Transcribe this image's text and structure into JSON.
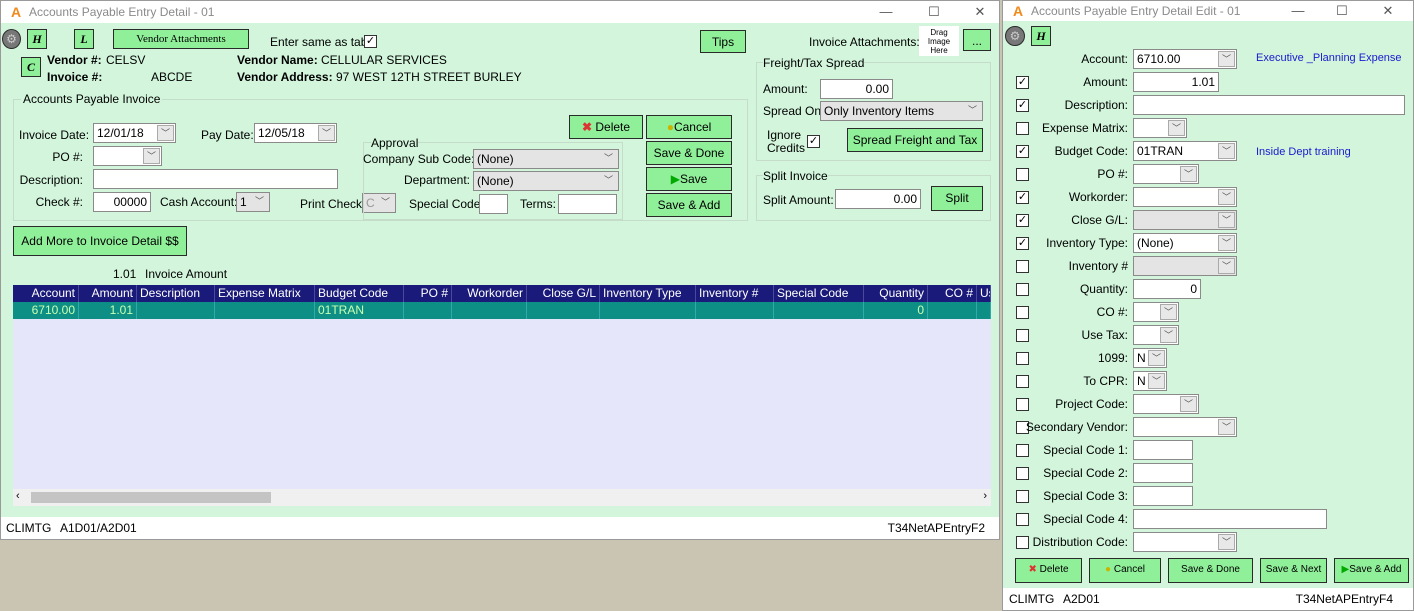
{
  "main_window": {
    "title": "Accounts Payable Entry Detail - 01",
    "toolbar": {
      "h_label": "H",
      "l_label": "L",
      "c_label": "C",
      "vendor_attachments": "Vendor Attachments",
      "enter_same_as_tab": "Enter same as tab",
      "enter_same_as_tab_checked": true,
      "tips": "Tips",
      "invoice_attachments": "Invoice Attachments:",
      "drag_image": "Drag Image Here",
      "browse": "..."
    },
    "vendor": {
      "vendor_num_label": "Vendor #:",
      "vendor_num": "CELSV",
      "invoice_num_label": "Invoice #:",
      "invoice_num": "ABCDE",
      "vendor_name_label": "Vendor Name:",
      "vendor_name": "CELLULAR SERVICES",
      "vendor_address_label": "Vendor Address:",
      "vendor_address": "97 WEST 12TH STREET  BURLEY"
    },
    "invoice": {
      "group": "Accounts Payable Invoice",
      "invoice_date_label": "Invoice Date:",
      "invoice_date": "12/01/18",
      "pay_date_label": "Pay Date:",
      "pay_date": "12/05/18",
      "po_label": "PO #:",
      "po": "",
      "description_label": "Description:",
      "description": "",
      "check_label": "Check #:",
      "check": "00000",
      "cash_account_label": "Cash Account:",
      "cash_account": "1",
      "print_check_label": "Print Check:",
      "print_check": "C",
      "terms_label": "Terms:",
      "terms": ""
    },
    "approval": {
      "group": "Approval",
      "company_sub_code_label": "Company Sub Code:",
      "company_sub_code": "(None)",
      "department_label": "Department:",
      "department": "(None)",
      "special_code_label": "Special Code:",
      "special_code": ""
    },
    "buttons": {
      "delete": "Delete",
      "cancel": "Cancel",
      "save_done": "Save & Done",
      "save": "Save",
      "save_add": "Save & Add",
      "add_more": "Add More to Invoice Detail $$"
    },
    "freight": {
      "group": "Freight/Tax Spread",
      "amount_label": "Amount:",
      "amount": "0.00",
      "spread_on_label": "Spread On:",
      "spread_on": "Only Inventory Items",
      "ignore_credits_label": "Ignore Credits",
      "ignore_credits": true,
      "spread_button": "Spread Freight and Tax"
    },
    "split": {
      "group": "Split Invoice",
      "amount_label": "Split Amount:",
      "amount": "0.00",
      "button": "Split"
    },
    "invoice_amount": "1.01",
    "invoice_amount_label": "Invoice Amount",
    "grid": {
      "columns": [
        "Account",
        "Amount",
        "Description",
        "Expense Matrix",
        "Budget Code",
        "PO #",
        "Workorder",
        "Close G/L",
        "Inventory Type",
        "Inventory #",
        "Special Code",
        "Quantity",
        "CO #",
        "Us"
      ],
      "rows": [
        [
          "6710.00",
          "1.01",
          "",
          "",
          "01TRAN",
          "",
          "",
          "",
          "",
          "",
          "",
          "0",
          "",
          ""
        ]
      ]
    },
    "status": {
      "user": "CLIMTG",
      "location": "A1D01/A2D01",
      "form": "T34NetAPEntryF2"
    }
  },
  "edit_window": {
    "title": "Accounts Payable Entry Detail Edit - 01",
    "h_label": "H",
    "account_desc": "Executive _Planning Expense",
    "budget_desc": "Inside Dept training",
    "fields": [
      {
        "label": "Account:",
        "value": "6710.00",
        "type": "select",
        "checkbox": null
      },
      {
        "label": "Amount:",
        "value": "1.01",
        "type": "text",
        "checkbox": true
      },
      {
        "label": "Description:",
        "value": "",
        "type": "text",
        "checkbox": true
      },
      {
        "label": "Expense Matrix:",
        "value": "",
        "type": "select",
        "checkbox": false
      },
      {
        "label": "Budget Code:",
        "value": "01TRAN",
        "type": "select",
        "checkbox": true
      },
      {
        "label": "PO #:",
        "value": "",
        "type": "select",
        "checkbox": false
      },
      {
        "label": "Workorder:",
        "value": "",
        "type": "select",
        "checkbox": true
      },
      {
        "label": "Close G/L:",
        "value": "",
        "type": "select-disabled",
        "checkbox": true
      },
      {
        "label": "Inventory Type:",
        "value": "(None)",
        "type": "select",
        "checkbox": true
      },
      {
        "label": "Inventory #",
        "value": "",
        "type": "select-disabled",
        "checkbox": false
      },
      {
        "label": "Quantity:",
        "value": "0",
        "type": "text",
        "checkbox": false
      },
      {
        "label": "CO #:",
        "value": "",
        "type": "select",
        "checkbox": false
      },
      {
        "label": "Use Tax:",
        "value": "",
        "type": "select",
        "checkbox": false
      },
      {
        "label": "1099:",
        "value": "N",
        "type": "select",
        "checkbox": false
      },
      {
        "label": "To CPR:",
        "value": "N",
        "type": "select",
        "checkbox": false
      },
      {
        "label": "Project Code:",
        "value": "",
        "type": "select",
        "checkbox": false
      },
      {
        "label": "Secondary Vendor:",
        "value": "",
        "type": "select",
        "checkbox": false
      },
      {
        "label": "Special Code 1:",
        "value": "",
        "type": "text",
        "checkbox": false
      },
      {
        "label": "Special Code 2:",
        "value": "",
        "type": "text",
        "checkbox": false
      },
      {
        "label": "Special Code 3:",
        "value": "",
        "type": "text",
        "checkbox": false
      },
      {
        "label": "Special Code 4:",
        "value": "",
        "type": "text",
        "checkbox": false
      },
      {
        "label": "Distribution Code:",
        "value": "",
        "type": "select",
        "checkbox": false
      }
    ],
    "buttons": {
      "delete": "Delete",
      "cancel": "Cancel",
      "save_done": "Save & Done",
      "save_next": "Save & Next",
      "save_add": "Save & Add"
    },
    "status": {
      "user": "CLIMTG",
      "location": "A2D01",
      "form": "T34NetAPEntryF4"
    }
  }
}
